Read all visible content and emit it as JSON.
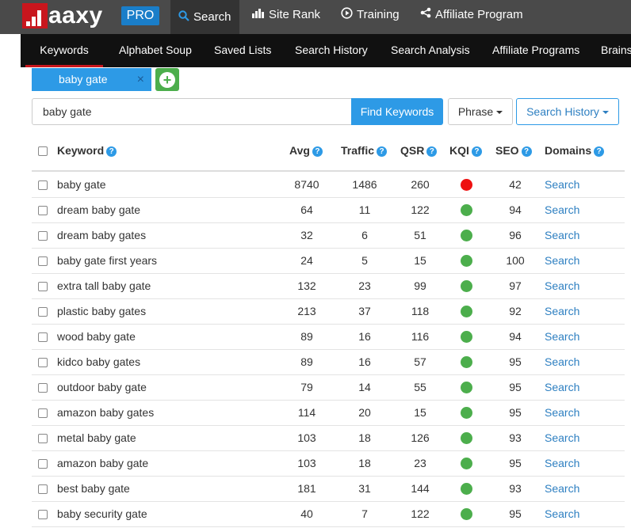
{
  "brand": {
    "name": "aaxy",
    "badge": "PRO"
  },
  "topnav": [
    {
      "label": "Search",
      "icon": "search-icon"
    },
    {
      "label": "Site Rank",
      "icon": "bar-chart-icon"
    },
    {
      "label": "Training",
      "icon": "play-circle-icon"
    },
    {
      "label": "Affiliate Program",
      "icon": "share-icon"
    }
  ],
  "subnav": [
    "Keywords",
    "Alphabet Soup",
    "Saved Lists",
    "Search History",
    "Search Analysis",
    "Affiliate Programs",
    "Brains"
  ],
  "search_tab": {
    "label": "baby gate",
    "close": "×"
  },
  "search": {
    "value": "baby gate",
    "find_label": "Find Keywords",
    "phrase_label": "Phrase",
    "history_label": "Search History"
  },
  "table": {
    "headers": {
      "keyword": "Keyword",
      "avg": "Avg",
      "traffic": "Traffic",
      "qsr": "QSR",
      "kqi": "KQI",
      "seo": "SEO",
      "domains": "Domains"
    },
    "help_glyph": "?",
    "rows": [
      {
        "keyword": "baby gate",
        "avg": "8740",
        "traffic": "1486",
        "qsr": "260",
        "kqi": "red",
        "seo": "42",
        "domains": "Search"
      },
      {
        "keyword": "dream baby gate",
        "avg": "64",
        "traffic": "11",
        "qsr": "122",
        "kqi": "green",
        "seo": "94",
        "domains": "Search"
      },
      {
        "keyword": "dream baby gates",
        "avg": "32",
        "traffic": "6",
        "qsr": "51",
        "kqi": "green",
        "seo": "96",
        "domains": "Search"
      },
      {
        "keyword": "baby gate first years",
        "avg": "24",
        "traffic": "5",
        "qsr": "15",
        "kqi": "green",
        "seo": "100",
        "domains": "Search"
      },
      {
        "keyword": "extra tall baby gate",
        "avg": "132",
        "traffic": "23",
        "qsr": "99",
        "kqi": "green",
        "seo": "97",
        "domains": "Search"
      },
      {
        "keyword": "plastic baby gates",
        "avg": "213",
        "traffic": "37",
        "qsr": "118",
        "kqi": "green",
        "seo": "92",
        "domains": "Search"
      },
      {
        "keyword": "wood baby gate",
        "avg": "89",
        "traffic": "16",
        "qsr": "116",
        "kqi": "green",
        "seo": "94",
        "domains": "Search"
      },
      {
        "keyword": "kidco baby gates",
        "avg": "89",
        "traffic": "16",
        "qsr": "57",
        "kqi": "green",
        "seo": "95",
        "domains": "Search"
      },
      {
        "keyword": "outdoor baby gate",
        "avg": "79",
        "traffic": "14",
        "qsr": "55",
        "kqi": "green",
        "seo": "95",
        "domains": "Search"
      },
      {
        "keyword": "amazon baby gates",
        "avg": "114",
        "traffic": "20",
        "qsr": "15",
        "kqi": "green",
        "seo": "95",
        "domains": "Search"
      },
      {
        "keyword": "metal baby gate",
        "avg": "103",
        "traffic": "18",
        "qsr": "126",
        "kqi": "green",
        "seo": "93",
        "domains": "Search"
      },
      {
        "keyword": "amazon baby gate",
        "avg": "103",
        "traffic": "18",
        "qsr": "23",
        "kqi": "green",
        "seo": "95",
        "domains": "Search"
      },
      {
        "keyword": "best baby gate",
        "avg": "181",
        "traffic": "31",
        "qsr": "144",
        "kqi": "green",
        "seo": "93",
        "domains": "Search"
      },
      {
        "keyword": "baby security gate",
        "avg": "40",
        "traffic": "7",
        "qsr": "122",
        "kqi": "green",
        "seo": "95",
        "domains": "Search"
      }
    ]
  },
  "colors": {
    "kqi_red": "#ee1111",
    "kqi_green": "#4cae4c",
    "accent": "#2d9ae6",
    "brand_red": "#c8161d"
  }
}
